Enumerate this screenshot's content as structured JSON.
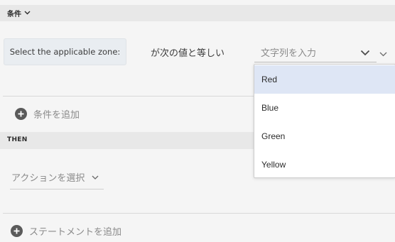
{
  "when_section": {
    "label": "条件"
  },
  "condition": {
    "zone_label": "Select the applicable zone:",
    "operator": "が次の値と等しい",
    "value_placeholder": "文字列を入力"
  },
  "add_condition": {
    "label": "条件を追加"
  },
  "then_section": {
    "label": "THEN"
  },
  "action": {
    "placeholder": "アクションを選択"
  },
  "add_statement": {
    "label": "ステートメントを追加"
  },
  "dropdown": {
    "options": [
      "Red",
      "Blue",
      "Green",
      "Yellow"
    ],
    "highlighted": "Red"
  },
  "colors": {
    "section_bar": "#e8e8e8",
    "highlight": "#dee6f5",
    "background": "#f5f5f5"
  }
}
